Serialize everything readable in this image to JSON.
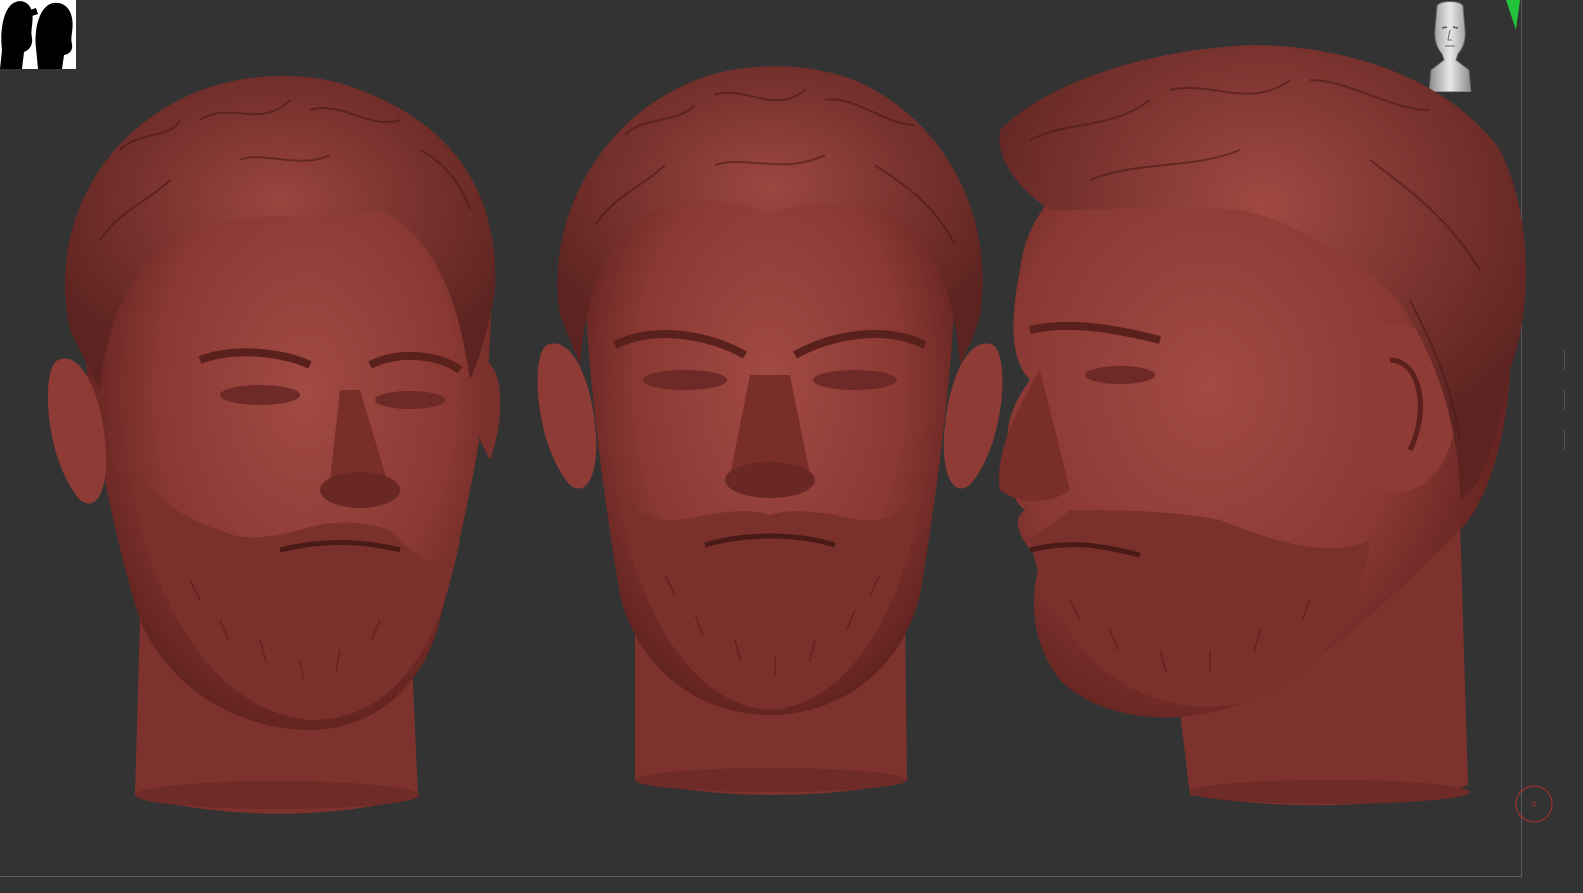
{
  "app": {
    "type": "3d-sculpt-viewport",
    "background_color": "#333333",
    "sculpt_material_color": "#8c3a36",
    "accent_green": "#22c23a",
    "cursor_color": "#b03030"
  },
  "viewport": {
    "thumbnail": {
      "icon": "silhouette-heads-icon"
    },
    "navigator": {
      "icon": "orientation-head-icon"
    },
    "marker": {
      "icon": "green-triangle-marker-icon"
    },
    "cursor": {
      "icon": "brush-cursor-ring-icon"
    },
    "models": [
      {
        "view": "three-quarter-left",
        "icon": "sculpted-head-icon"
      },
      {
        "view": "front",
        "icon": "sculpted-head-icon"
      },
      {
        "view": "profile-right",
        "icon": "sculpted-head-icon"
      }
    ]
  }
}
